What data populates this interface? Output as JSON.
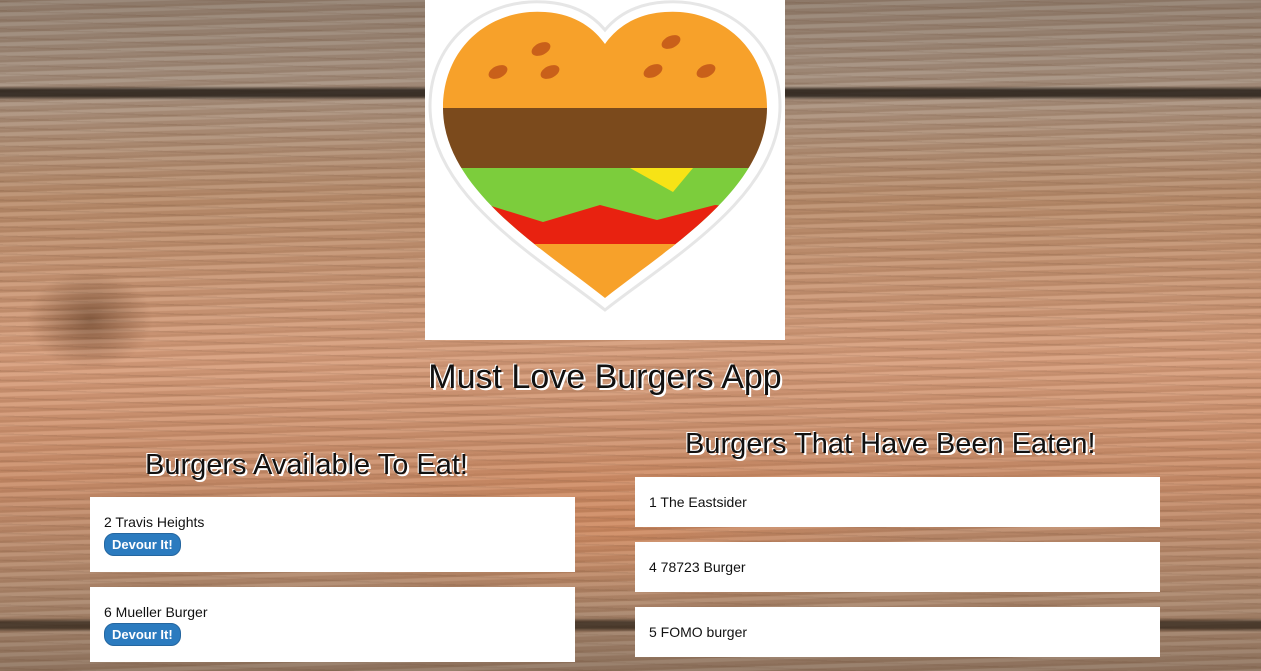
{
  "app": {
    "title": "Must Love Burgers App",
    "logo_icon": "burger-heart-icon"
  },
  "available": {
    "heading": "Burgers Available To Eat!",
    "button_label": "Devour It!",
    "items": [
      {
        "label": "2 Travis Heights"
      },
      {
        "label": "6 Mueller Burger"
      }
    ]
  },
  "eaten": {
    "heading": "Burgers That Have Been Eaten!",
    "items": [
      {
        "label": "1 The Eastsider"
      },
      {
        "label": "4 78723 Burger"
      },
      {
        "label": "5 FOMO burger"
      }
    ]
  },
  "colors": {
    "button": "#2b7bbf",
    "bun": "#f7a12a",
    "patty": "#7b4a1c",
    "lettuce": "#7ccd3c",
    "tomato": "#e82210",
    "cheese": "#f7e316"
  }
}
